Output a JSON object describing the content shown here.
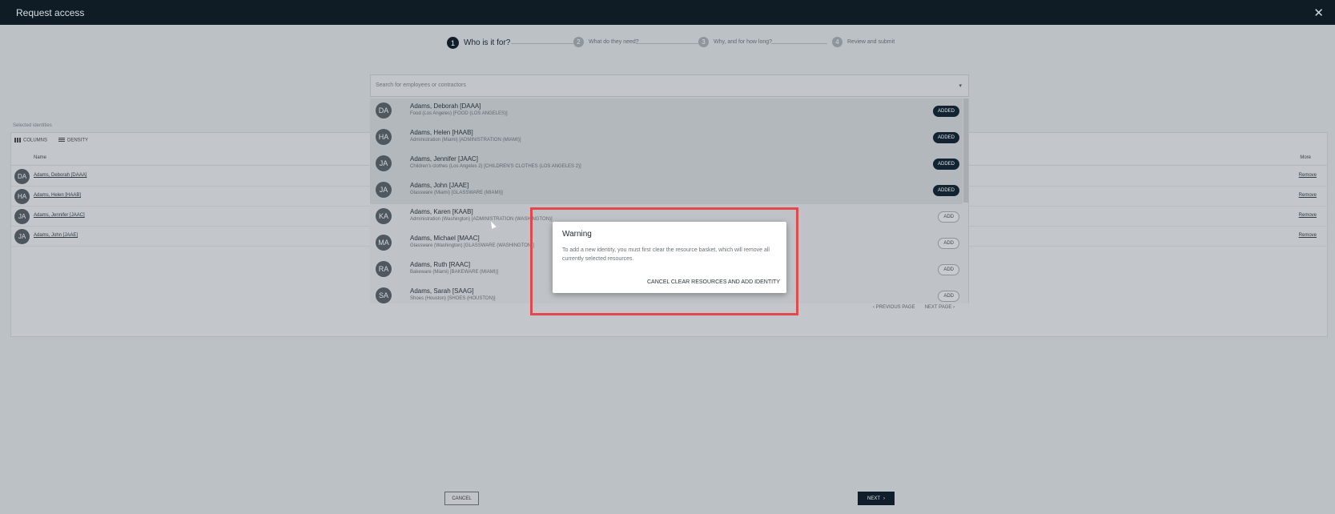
{
  "window": {
    "title": "Request access",
    "close_glyph": "✕"
  },
  "stepper": {
    "steps": [
      {
        "num": "1",
        "label": "Who is it for?"
      },
      {
        "num": "2",
        "label": "What do they need?"
      },
      {
        "num": "3",
        "label": "Why, and for how long?"
      },
      {
        "num": "4",
        "label": "Review and submit"
      }
    ]
  },
  "search": {
    "placeholder": "Search for employees or contractors",
    "caret": "▾"
  },
  "options": [
    {
      "initials": "DA",
      "name": "Adams, Deborah [DAAA]",
      "sub": "Food (Los Angeles) [FOOD (LOS ANGELES)]",
      "action": "ADDED"
    },
    {
      "initials": "HA",
      "name": "Adams, Helen [HAAB]",
      "sub": "Administration (Miami) [ADMINISTRATION (MIAMI)]",
      "action": "ADDED"
    },
    {
      "initials": "JA",
      "name": "Adams, Jennifer [JAAC]",
      "sub": "Children's clothes (Los Angeles 2) [CHILDREN'S CLOTHES (LOS ANGELES 2)]",
      "action": "ADDED"
    },
    {
      "initials": "JA",
      "name": "Adams, John [JAAE]",
      "sub": "Glassware (Miami) [GLASSWARE (MIAMI)]",
      "action": "ADDED"
    },
    {
      "initials": "KA",
      "name": "Adams, Karen [KAAB]",
      "sub": "Administration (Washington) [ADMINISTRATION (WASHINGTON)]",
      "action": "ADD"
    },
    {
      "initials": "MA",
      "name": "Adams, Michael [MAAC]",
      "sub": "Glassware (Washington) [GLASSWARE (WASHINGTON)]",
      "action": "ADD"
    },
    {
      "initials": "RA",
      "name": "Adams, Ruth [RAAC]",
      "sub": "Bakeware (Miami) [BAKEWARE (MIAMI)]",
      "action": "ADD"
    },
    {
      "initials": "SA",
      "name": "Adams, Sarah [SAAG]",
      "sub": "Shoes (Houston) [SHOES (HOUSTON)]",
      "action": "ADD"
    }
  ],
  "pager": {
    "prev": "‹  PREVIOUS PAGE",
    "next": "NEXT PAGE  ›"
  },
  "selected": {
    "caption": "Selected identities",
    "columns_label": "COLUMNS",
    "density_label": "DENSITY",
    "name_header": "Name",
    "more_header": "More",
    "remove_label": "Remove",
    "rows": [
      {
        "initials": "DA",
        "name": "Adams, Deborah [DAAA]"
      },
      {
        "initials": "HA",
        "name": "Adams, Helen [HAAB]"
      },
      {
        "initials": "JA",
        "name": "Adams, Jennifer [JAAC]"
      },
      {
        "initials": "JA",
        "name": "Adams, John [JAAE]"
      }
    ]
  },
  "footer": {
    "cancel": "CANCEL",
    "next": "NEXT",
    "next_glyph": "›"
  },
  "modal": {
    "title": "Warning",
    "body": "To add a new identity, you must first clear the resource basket, which will remove all currently selected resources.",
    "cancel": "CANCEL",
    "confirm": "CLEAR RESOURCES AND ADD IDENTITY"
  },
  "colors": {
    "highlight": "#e2484c",
    "topbar": "#0f1c26",
    "accent": "#122331"
  }
}
